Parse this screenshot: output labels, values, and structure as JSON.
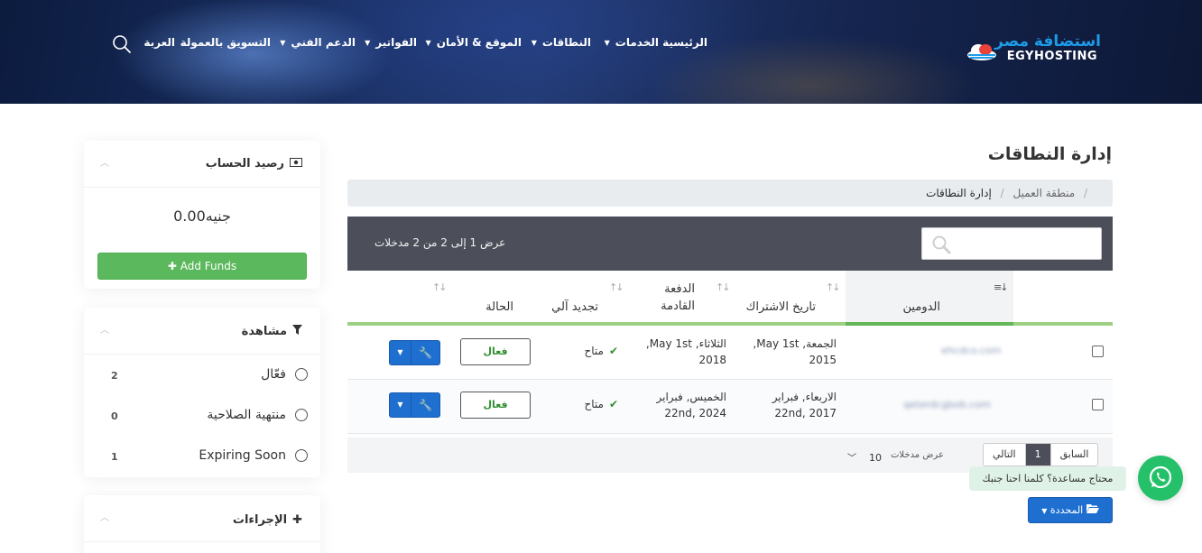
{
  "header": {
    "logo_ar": "استضافة مصر",
    "logo_en": "EGYHOSTING",
    "nav": [
      {
        "label": "الرئيسية",
        "dropdown": false
      },
      {
        "label": "الخدمات",
        "dropdown": true
      },
      {
        "label": "النطاقات",
        "dropdown": true
      },
      {
        "label": "الموقع & الأمان",
        "dropdown": true
      },
      {
        "label": "الفواتير",
        "dropdown": true
      },
      {
        "label": "الدعم الفني",
        "dropdown": true
      },
      {
        "label": "التسويق بالعمولة",
        "dropdown": false
      },
      {
        "label": "العربة",
        "dropdown": false
      }
    ]
  },
  "sidebar": {
    "balance_panel": {
      "title": "رصيد الحساب",
      "amount": "جنيه0.00",
      "add_funds": "Add Funds"
    },
    "view_panel": {
      "title": "مشاهدة",
      "filters": [
        {
          "label": "فعّال",
          "count": "2"
        },
        {
          "label": "منتهية الصلاحية",
          "count": "0"
        },
        {
          "label": "Expiring Soon",
          "count": "1"
        }
      ]
    },
    "actions_panel": {
      "title": "الإجراءات"
    }
  },
  "main": {
    "title": "إدارة النطاقات",
    "breadcrumb": {
      "home": "منطقة العميل",
      "current": "إدارة النطاقات"
    },
    "table": {
      "info": "عرض 1 إلى 2 من 2 مدخلات",
      "headers": {
        "domain": "الدومين",
        "reg_date": "تاريخ الاشتراك",
        "next_due_1": "الدفعة",
        "next_due_2": "القادمة",
        "auto_renew": "تجديد آلي",
        "status": "الحالة"
      },
      "rows": [
        {
          "domain": "ehcdco.com",
          "reg_line1": "الجمعة, May 1st,",
          "reg_line2": "2015",
          "due_line1": "الثلاثاء, May 1st,",
          "due_line2": "2018",
          "auto_renew": "متاح",
          "status": "فعال"
        },
        {
          "domain": "qeterdcgbob.com",
          "reg_line1": "الاربعاء, فبراير",
          "reg_line2": "22nd, 2017",
          "due_line1": "الخميس, فبراير",
          "due_line2": "22nd, 2024",
          "auto_renew": "متاح",
          "status": "فعال"
        }
      ],
      "pager": {
        "prev": "السابق",
        "page": "1",
        "next": "التالي"
      },
      "per_page_label": "عرض مدخلات",
      "per_page_value": "10"
    },
    "with_selected": "المحددة"
  },
  "help_bubble": "محتاج مساعدة؟ كلمنا احنا جنبك",
  "colors": {
    "accent_green": "#5cb85c",
    "primary_blue": "#1f6fd1",
    "whatsapp": "#25c16a",
    "toolbar": "#4c4f5a"
  }
}
